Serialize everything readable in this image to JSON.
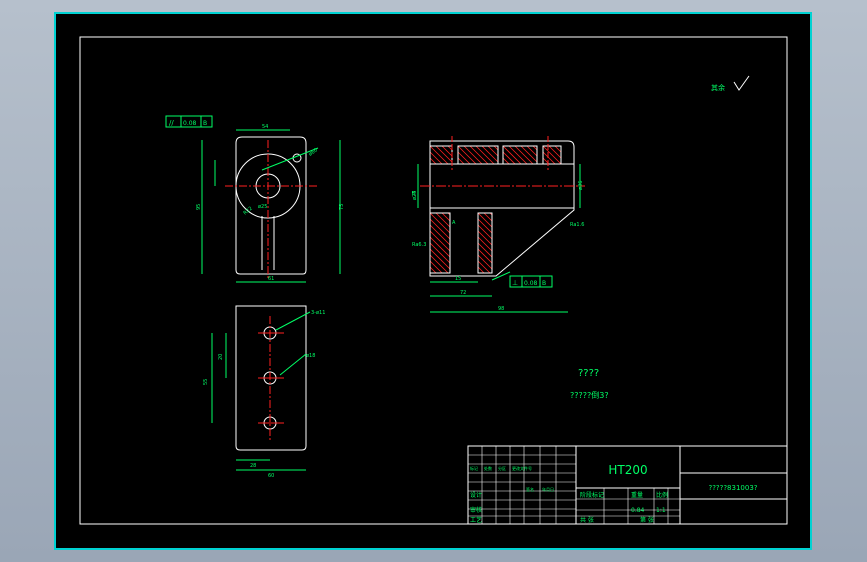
{
  "colors": {
    "background": "#000000",
    "frame": "#00d2d2",
    "border": "#ffffff",
    "geometry": "#ffffff",
    "dimension": "#00ff66",
    "centerline": "#ff2020",
    "hatch": "#ff2020",
    "text": "#00ff66",
    "title_text": "#00ff66"
  },
  "drawing": {
    "roughness_note": "其余",
    "tech_requirements_title": "????",
    "tech_requirements_line": "?????倒3?",
    "front_view": {
      "parallelism_symbol": "//",
      "parallelism_value": "0.08",
      "parallelism_datum": "B",
      "dims": [
        "ø25",
        "ø60",
        "R22",
        "95",
        "75",
        "61",
        "54"
      ]
    },
    "section_view": {
      "perpendicularity_symbol": "⊥",
      "perpendicularity_value": "0.08",
      "perpendicularity_datum": "B",
      "dims": [
        "ø36",
        "ø25",
        "98",
        "72",
        "15",
        "B",
        "A",
        "Ra1.6",
        "Ra6.3"
      ]
    },
    "bottom_view": {
      "dims": [
        "3-ø11",
        "ø18",
        "55",
        "20",
        "28",
        "60"
      ]
    }
  },
  "title_block": {
    "material": "HT200",
    "drawing_number": "?????831003?",
    "row_labels": [
      "设计",
      "审核",
      "工艺"
    ],
    "col_labels": [
      "标记",
      "处数",
      "分区",
      "更改文件号",
      "签名",
      "年月日"
    ],
    "stage_label": "阶段标记",
    "weight_label": "重量",
    "scale_label": "比例",
    "scale_value": "1:1",
    "weight_value": "0.84",
    "sheet_total": "共 张",
    "sheet_no": "第 张"
  }
}
